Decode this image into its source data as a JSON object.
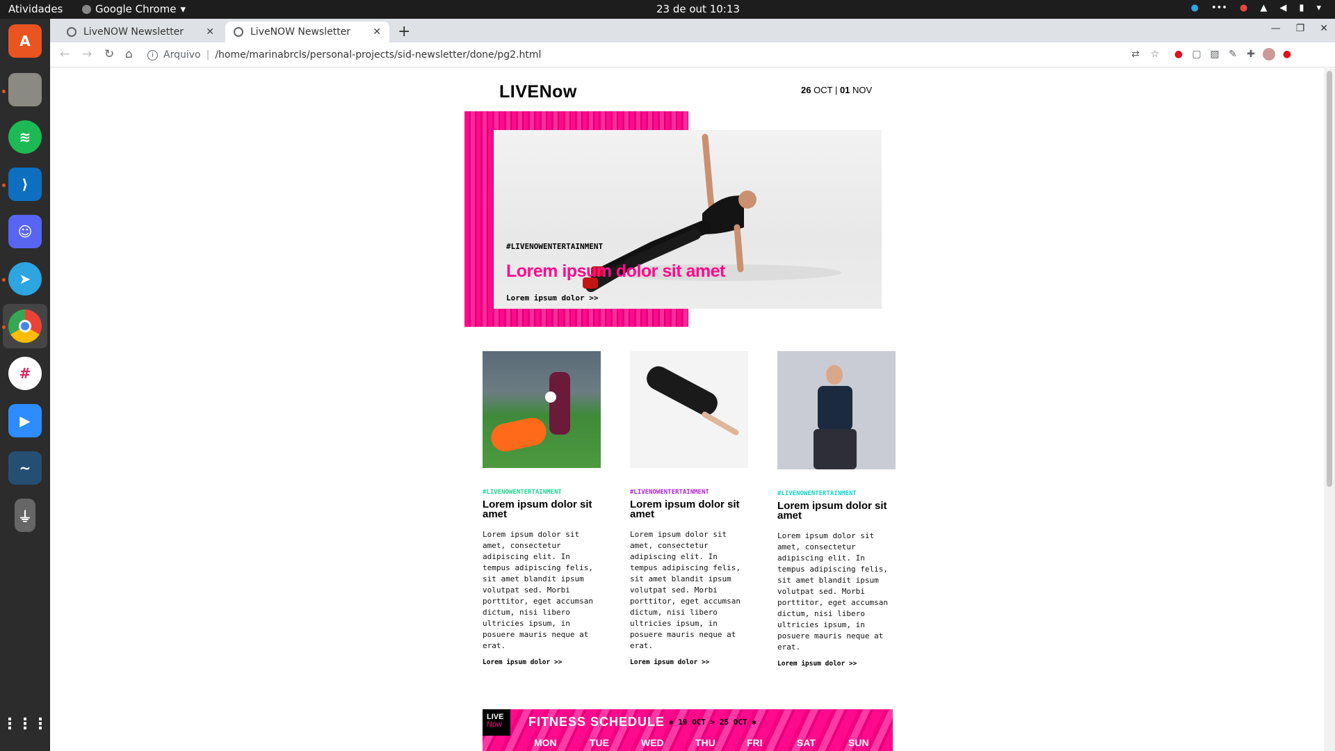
{
  "os": {
    "activities": "Atividades",
    "app_name": "Google Chrome",
    "clock": "23 de out  10:13",
    "tray_more": "•••"
  },
  "browser": {
    "tabs": [
      {
        "label": "LiveNOW Newsletter"
      },
      {
        "label": "LiveNOW Newsletter"
      }
    ],
    "scheme": "Arquivo",
    "url": "/home/marinabrcls/personal-projects/sid-newsletter/done/pg2.html"
  },
  "newsletter": {
    "logo_live": "LIVE",
    "logo_now": "Now",
    "date_start_day": "26",
    "date_start_month": "OCT",
    "date_sep": "|",
    "date_end_day": "01",
    "date_end_month": "NOV",
    "hero": {
      "tag": "#LIVENOWENTERTAINMENT",
      "title": "Lorem ipsum dolor sit amet",
      "link": "Lorem ipsum dolor >>"
    },
    "articles": [
      {
        "tag": "#LIVENOWENTERTAINMENT",
        "tag_color": "#1ed98f",
        "title": "Lorem ipsum dolor sit amet",
        "body": "Lorem ipsum dolor sit amet, consectetur adipiscing elit. In tempus adipiscing felis, sit amet blandit ipsum volutpat sed. Morbi porttitor, eget accumsan dictum, nisi libero ultricies ipsum, in posuere mauris neque at erat.",
        "link": "Lorem ipsum dolor >>"
      },
      {
        "tag": "#LIVENOWENTERTAINMENT",
        "tag_color": "#b21fd6",
        "title": "Lorem ipsum dolor sit amet",
        "body": "Lorem ipsum dolor sit amet, consectetur adipiscing elit. In tempus adipiscing felis, sit amet blandit ipsum volutpat sed. Morbi porttitor, eget accumsan dictum, nisi libero ultricies ipsum, in posuere mauris neque at erat.",
        "link": "Lorem ipsum dolor >>"
      },
      {
        "tag": "#LIVENOWENTERTAINMENT",
        "tag_color": "#17d3c8",
        "title": "Lorem ipsum dolor sit amet",
        "body": "Lorem ipsum dolor sit amet, consectetur adipiscing elit. In tempus adipiscing felis, sit amet blandit ipsum volutpat sed. Morbi porttitor, eget accumsan dictum, nisi libero ultricies ipsum, in posuere mauris neque at erat.",
        "link": "Lorem ipsum dolor >>"
      }
    ],
    "schedule": {
      "logo_live": "LIVE",
      "logo_now": "Now",
      "title": "FITNESS SCHEDULE",
      "dates": "✱ 19 OCT > 25 OCT ✱",
      "days": [
        "MON",
        "TUE",
        "WED",
        "THU",
        "FRI",
        "SAT",
        "SUN"
      ]
    }
  },
  "colors": {
    "brand_pink": "#ff0a8c",
    "topbar": "#1d1d1d",
    "dock": "#2c2c2c"
  }
}
